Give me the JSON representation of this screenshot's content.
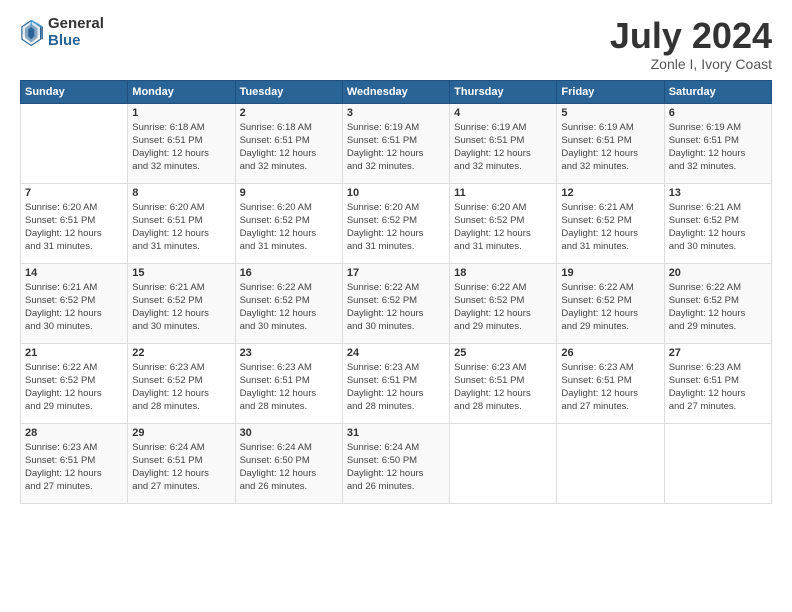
{
  "logo": {
    "general": "General",
    "blue": "Blue"
  },
  "title": "July 2024",
  "location": "Zonle I, Ivory Coast",
  "days_header": [
    "Sunday",
    "Monday",
    "Tuesday",
    "Wednesday",
    "Thursday",
    "Friday",
    "Saturday"
  ],
  "weeks": [
    [
      {
        "day": "",
        "info": ""
      },
      {
        "day": "1",
        "info": "Sunrise: 6:18 AM\nSunset: 6:51 PM\nDaylight: 12 hours\nand 32 minutes."
      },
      {
        "day": "2",
        "info": "Sunrise: 6:18 AM\nSunset: 6:51 PM\nDaylight: 12 hours\nand 32 minutes."
      },
      {
        "day": "3",
        "info": "Sunrise: 6:19 AM\nSunset: 6:51 PM\nDaylight: 12 hours\nand 32 minutes."
      },
      {
        "day": "4",
        "info": "Sunrise: 6:19 AM\nSunset: 6:51 PM\nDaylight: 12 hours\nand 32 minutes."
      },
      {
        "day": "5",
        "info": "Sunrise: 6:19 AM\nSunset: 6:51 PM\nDaylight: 12 hours\nand 32 minutes."
      },
      {
        "day": "6",
        "info": "Sunrise: 6:19 AM\nSunset: 6:51 PM\nDaylight: 12 hours\nand 32 minutes."
      }
    ],
    [
      {
        "day": "7",
        "info": "Sunrise: 6:20 AM\nSunset: 6:51 PM\nDaylight: 12 hours\nand 31 minutes."
      },
      {
        "day": "8",
        "info": "Sunrise: 6:20 AM\nSunset: 6:51 PM\nDaylight: 12 hours\nand 31 minutes."
      },
      {
        "day": "9",
        "info": "Sunrise: 6:20 AM\nSunset: 6:52 PM\nDaylight: 12 hours\nand 31 minutes."
      },
      {
        "day": "10",
        "info": "Sunrise: 6:20 AM\nSunset: 6:52 PM\nDaylight: 12 hours\nand 31 minutes."
      },
      {
        "day": "11",
        "info": "Sunrise: 6:20 AM\nSunset: 6:52 PM\nDaylight: 12 hours\nand 31 minutes."
      },
      {
        "day": "12",
        "info": "Sunrise: 6:21 AM\nSunset: 6:52 PM\nDaylight: 12 hours\nand 31 minutes."
      },
      {
        "day": "13",
        "info": "Sunrise: 6:21 AM\nSunset: 6:52 PM\nDaylight: 12 hours\nand 30 minutes."
      }
    ],
    [
      {
        "day": "14",
        "info": "Sunrise: 6:21 AM\nSunset: 6:52 PM\nDaylight: 12 hours\nand 30 minutes."
      },
      {
        "day": "15",
        "info": "Sunrise: 6:21 AM\nSunset: 6:52 PM\nDaylight: 12 hours\nand 30 minutes."
      },
      {
        "day": "16",
        "info": "Sunrise: 6:22 AM\nSunset: 6:52 PM\nDaylight: 12 hours\nand 30 minutes."
      },
      {
        "day": "17",
        "info": "Sunrise: 6:22 AM\nSunset: 6:52 PM\nDaylight: 12 hours\nand 30 minutes."
      },
      {
        "day": "18",
        "info": "Sunrise: 6:22 AM\nSunset: 6:52 PM\nDaylight: 12 hours\nand 29 minutes."
      },
      {
        "day": "19",
        "info": "Sunrise: 6:22 AM\nSunset: 6:52 PM\nDaylight: 12 hours\nand 29 minutes."
      },
      {
        "day": "20",
        "info": "Sunrise: 6:22 AM\nSunset: 6:52 PM\nDaylight: 12 hours\nand 29 minutes."
      }
    ],
    [
      {
        "day": "21",
        "info": "Sunrise: 6:22 AM\nSunset: 6:52 PM\nDaylight: 12 hours\nand 29 minutes."
      },
      {
        "day": "22",
        "info": "Sunrise: 6:23 AM\nSunset: 6:52 PM\nDaylight: 12 hours\nand 28 minutes."
      },
      {
        "day": "23",
        "info": "Sunrise: 6:23 AM\nSunset: 6:51 PM\nDaylight: 12 hours\nand 28 minutes."
      },
      {
        "day": "24",
        "info": "Sunrise: 6:23 AM\nSunset: 6:51 PM\nDaylight: 12 hours\nand 28 minutes."
      },
      {
        "day": "25",
        "info": "Sunrise: 6:23 AM\nSunset: 6:51 PM\nDaylight: 12 hours\nand 28 minutes."
      },
      {
        "day": "26",
        "info": "Sunrise: 6:23 AM\nSunset: 6:51 PM\nDaylight: 12 hours\nand 27 minutes."
      },
      {
        "day": "27",
        "info": "Sunrise: 6:23 AM\nSunset: 6:51 PM\nDaylight: 12 hours\nand 27 minutes."
      }
    ],
    [
      {
        "day": "28",
        "info": "Sunrise: 6:23 AM\nSunset: 6:51 PM\nDaylight: 12 hours\nand 27 minutes."
      },
      {
        "day": "29",
        "info": "Sunrise: 6:24 AM\nSunset: 6:51 PM\nDaylight: 12 hours\nand 27 minutes."
      },
      {
        "day": "30",
        "info": "Sunrise: 6:24 AM\nSunset: 6:50 PM\nDaylight: 12 hours\nand 26 minutes."
      },
      {
        "day": "31",
        "info": "Sunrise: 6:24 AM\nSunset: 6:50 PM\nDaylight: 12 hours\nand 26 minutes."
      },
      {
        "day": "",
        "info": ""
      },
      {
        "day": "",
        "info": ""
      },
      {
        "day": "",
        "info": ""
      }
    ]
  ]
}
